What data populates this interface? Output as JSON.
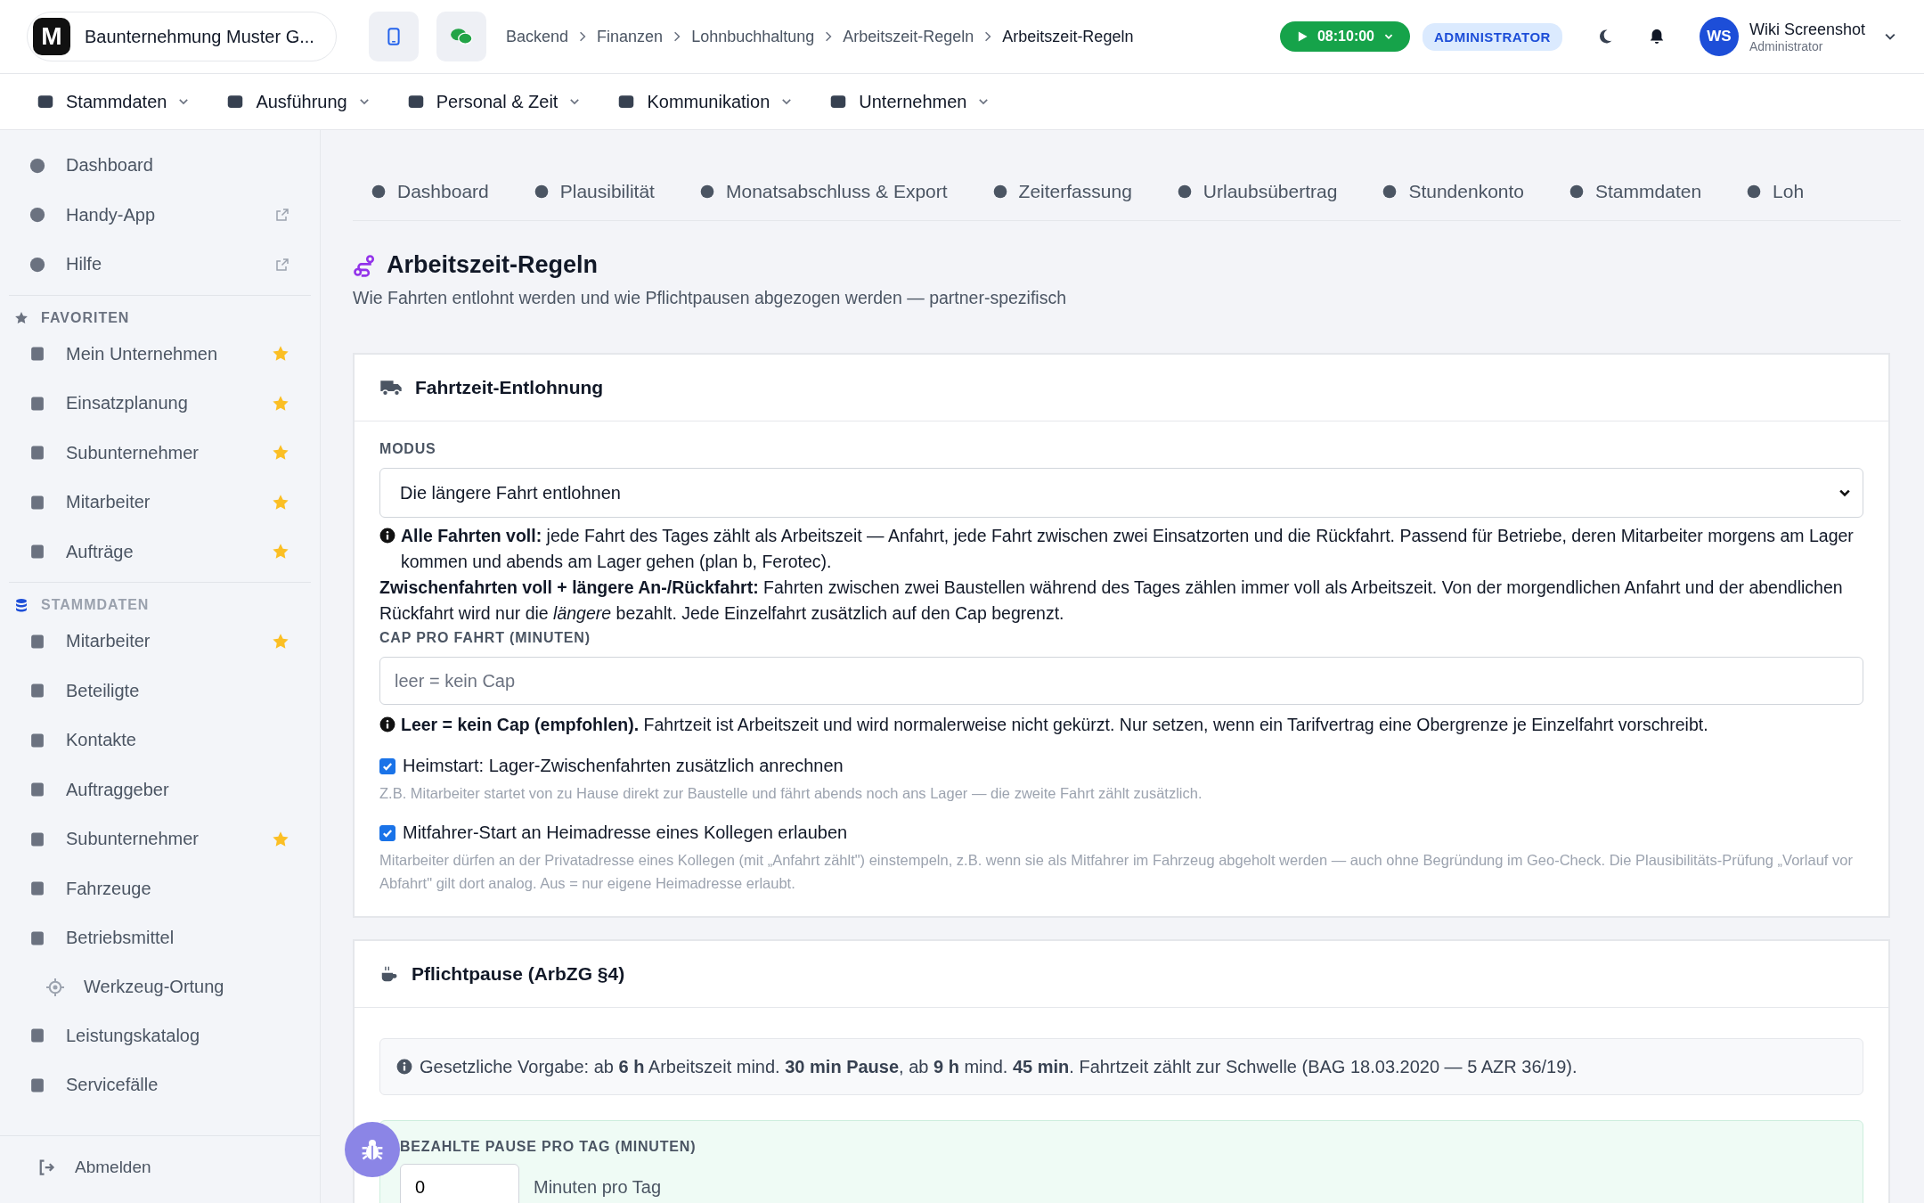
{
  "topbar": {
    "logo": "M",
    "company": "Baunternehmung Muster G...",
    "breadcrumbs": [
      "Backend",
      "Finanzen",
      "Lohnbuchhaltung",
      "Arbeitszeit-Regeln",
      "Arbeitszeit-Regeln"
    ],
    "timer": "08:10:00",
    "role": "ADMINISTRATOR",
    "user": {
      "initials": "WS",
      "name": "Wiki Screenshot",
      "role": "Administrator"
    }
  },
  "main_nav": [
    "Stammdaten",
    "Ausführung",
    "Personal & Zeit",
    "Kommunikation",
    "Unternehmen"
  ],
  "sidebar": {
    "top_items": [
      {
        "label": "Dashboard",
        "external": false
      },
      {
        "label": "Handy-App",
        "external": true
      },
      {
        "label": "Hilfe",
        "external": true
      }
    ],
    "sections": [
      {
        "title": "FAVORITEN",
        "items": [
          {
            "label": "Mein Unternehmen",
            "favorite": true
          },
          {
            "label": "Einsatzplanung",
            "favorite": true
          },
          {
            "label": "Subunternehmer",
            "favorite": true
          },
          {
            "label": "Mitarbeiter",
            "favorite": true
          },
          {
            "label": "Aufträge",
            "favorite": true
          }
        ]
      },
      {
        "title": "STAMMDATEN",
        "items": [
          {
            "label": "Mitarbeiter",
            "favorite": true
          },
          {
            "label": "Beteiligte",
            "favorite": false
          },
          {
            "label": "Kontakte",
            "favorite": false
          },
          {
            "label": "Auftraggeber",
            "favorite": false
          },
          {
            "label": "Subunternehmer",
            "favorite": true
          },
          {
            "label": "Fahrzeuge",
            "favorite": false
          },
          {
            "label": "Betriebsmittel",
            "favorite": false,
            "children": [
              {
                "label": "Werkzeug-Ortung",
                "favorite": false
              }
            ]
          },
          {
            "label": "Leistungskatalog",
            "favorite": false
          },
          {
            "label": "Servicefälle",
            "favorite": false
          }
        ]
      }
    ],
    "logout": "Abmelden"
  },
  "tabs": [
    "Dashboard",
    "Plausibilität",
    "Monatsabschluss & Export",
    "Zeiterfassung",
    "Urlaubsübertrag",
    "Stundenkonto",
    "Stammdaten",
    "Loh"
  ],
  "page": {
    "title": "Arbeitszeit-Regeln",
    "subtitle": "Wie Fahrten entlohnt werden und wie Pflichtpausen abgezogen werden — partner-spezifisch"
  },
  "travel_card": {
    "title": "Fahrtzeit-Entlohnung",
    "mode_label": "MODUS",
    "mode_value": "Die längere Fahrt entlohnen",
    "mode_help": [
      "**Alle Fahrten voll:** jede Fahrt des Tages zählt als Arbeitszeit — Anfahrt, jede Fahrt zwischen zwei Einsatzorten und die Rückfahrt. Passend für Betriebe, deren Mitarbeiter morgens am Lager kommen und abends am Lager gehen (plan b, Ferotec).",
      "**Zwischenfahrten voll + längere An-/Rückfahrt:** Fahrten zwischen zwei Baustellen während des Tages zählen immer voll als Arbeitszeit. Von der morgendlichen Anfahrt und der abendlichen Rückfahrt wird nur die *längere* bezahlt. Jede Einzelfahrt zusätzlich auf den Cap begrenzt."
    ],
    "cap_label": "CAP PRO FAHRT (MINUTEN)",
    "cap_placeholder": "leer = kein Cap",
    "cap_help": "**Leer = kein Cap (empfohlen).** Fahrtzeit ist Arbeitszeit und wird normalerweise nicht gekürzt. Nur setzen, wenn ein Tarifvertrag eine Obergrenze je Einzelfahrt vorschreibt.",
    "options": [
      {
        "label": "Heimstart: Lager-Zwischenfahrten zusätzlich anrechnen",
        "hint": "Z.B. Mitarbeiter startet von zu Hause direkt zur Baustelle und fährt abends noch ans Lager — die zweite Fahrt zählt zusätzlich.",
        "checked": true
      },
      {
        "label": "Mitfahrer-Start an Heimadresse eines Kollegen erlauben",
        "hint": "Mitarbeiter dürfen an der Privatadresse eines Kollegen (mit „Anfahrt zählt\") einstempeln, z.B. wenn sie als Mitfahrer im Fahrzeug abgeholt werden — auch ohne Begründung im Geo-Check. Die Plausibilitäts-Prüfung „Vorlauf vor Abfahrt\" gilt dort analog. Aus = nur eigene Heimadresse erlaubt.",
        "checked": true
      }
    ]
  },
  "break_card": {
    "title": "Pflichtpause (ArbZG §4)",
    "info": "Gesetzliche Vorgabe: ab **6 h** Arbeitszeit mind. **30 min Pause**, ab **9 h** mind. **45 min**. Fahrtzeit zählt zur Schwelle (BAG 18.03.2020 — 5 AZR 36/19).",
    "paid_label": "BEZAHLTE PAUSE PRO TAG (MINUTEN)",
    "paid_value": "0",
    "paid_unit": "Minuten pro Tag"
  }
}
